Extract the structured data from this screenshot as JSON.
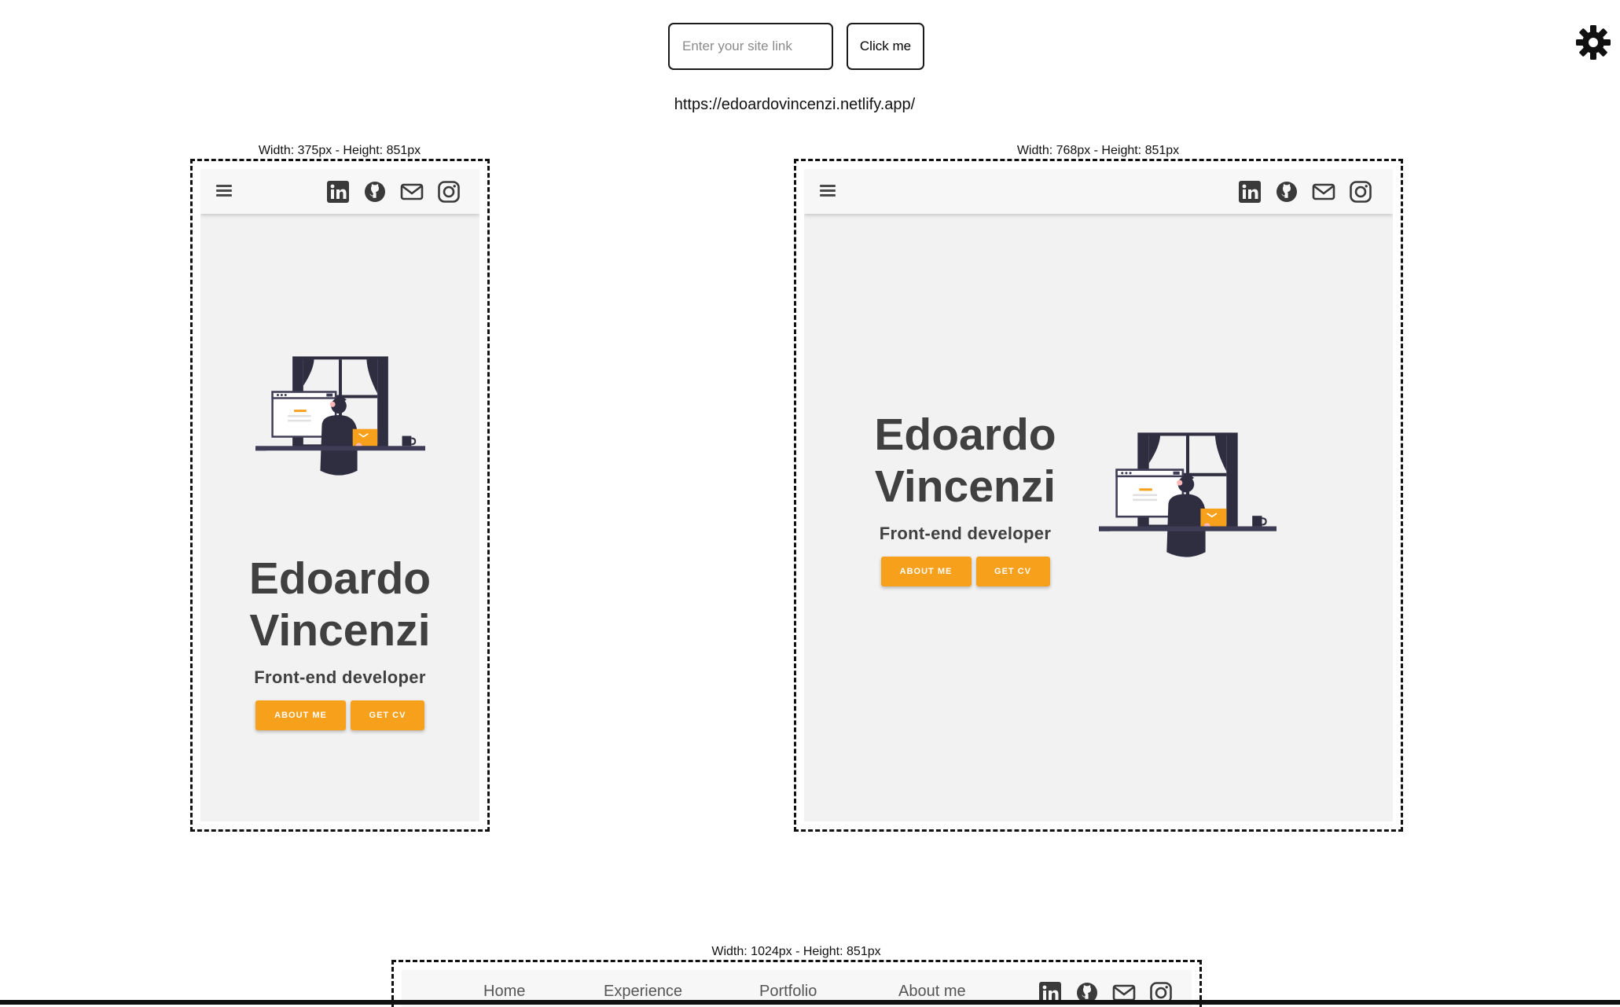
{
  "toolbar": {
    "input_placeholder": "Enter your site link",
    "button_label": "Click me",
    "current_url": "https://edoardovincenzi.netlify.app/"
  },
  "frames": [
    {
      "label": "Width: 375px - Height: 851px",
      "name": "Edoardo Vincenzi",
      "name_line1": "Edoardo",
      "name_line2": "Vincenzi",
      "role": "Front-end developer",
      "about_button": "ABOUT ME",
      "cv_button": "GET CV"
    },
    {
      "label": "Width: 768px - Height: 851px",
      "name_line1": "Edoardo",
      "name_line2": "Vincenzi",
      "role": "Front-end developer",
      "about_button": "ABOUT ME",
      "cv_button": "GET CV"
    },
    {
      "label": "Width: 1024px - Height: 851px",
      "nav_links": [
        "Home",
        "Experience",
        "Portfolio",
        "About me"
      ]
    }
  ],
  "icons": [
    "menu-icon",
    "linkedin-icon",
    "github-icon",
    "mail-icon",
    "instagram-icon",
    "gear-icon"
  ],
  "colors": {
    "accent": "#f7a01c",
    "text_dark": "#404040",
    "screen_bg": "#f2f2f2",
    "illustration_dark": "#2f2e41"
  }
}
